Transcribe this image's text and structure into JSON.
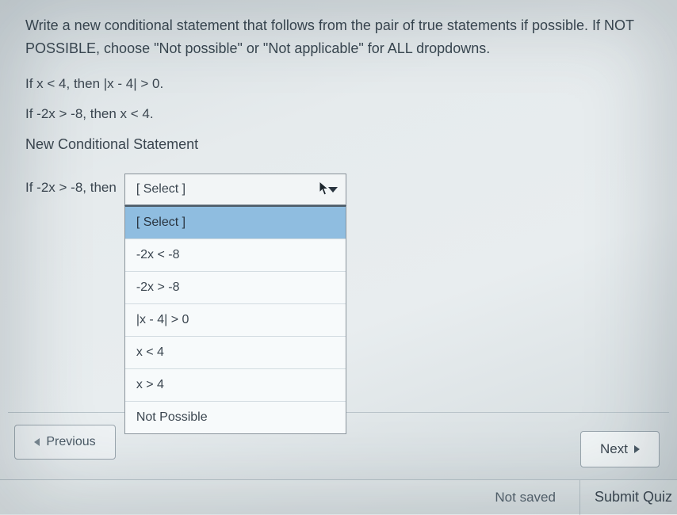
{
  "question": {
    "instructions": "Write a new conditional statement that follows from the pair of true statements if possible. If NOT POSSIBLE, choose \"Not possible\" or \"Not applicable\" for ALL dropdowns.",
    "statement1": "If x < 4, then |x - 4| > 0.",
    "statement2": "If -2x > -8, then x < 4.",
    "section_label": "New Conditional Statement",
    "prefix": "If -2x > -8, then",
    "select_placeholder": "[ Select ]",
    "options": [
      "[ Select ]",
      "-2x < -8",
      "-2x > -8",
      "|x - 4| > 0",
      "x < 4",
      "x > 4",
      "Not Possible"
    ]
  },
  "nav": {
    "previous": "Previous",
    "next": "Next"
  },
  "footer": {
    "status": "Not saved",
    "submit": "Submit Quiz"
  }
}
